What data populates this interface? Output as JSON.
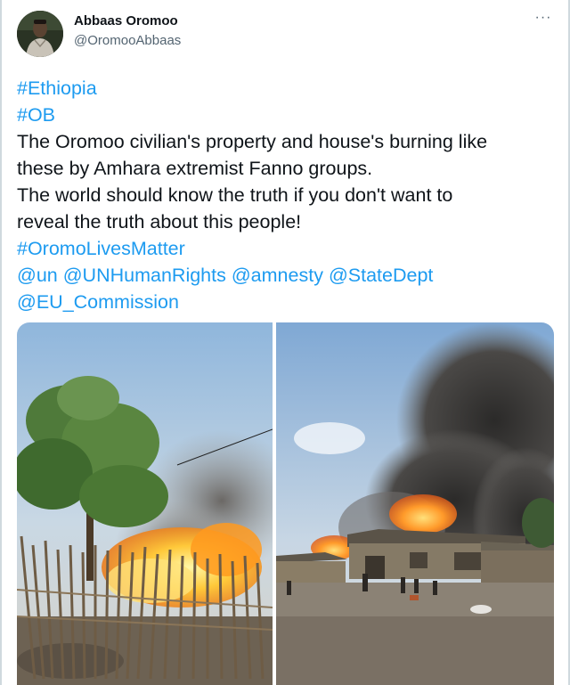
{
  "author": {
    "name": "Abbaas Oromoo",
    "handle": "@OromooAbbaas",
    "avatar_icon": "profile-photo"
  },
  "more_icon": "more-horizontal-icon",
  "more_label": "···",
  "tweet": {
    "lines": [
      {
        "parts": [
          {
            "text": "#Ethiopia",
            "link": true
          }
        ]
      },
      {
        "parts": [
          {
            "text": "#OB",
            "link": true
          }
        ]
      },
      {
        "parts": [
          {
            "text": "The Oromoo civilian's property and house's burning like",
            "link": false
          }
        ]
      },
      {
        "parts": [
          {
            "text": "these by Amhara extremist Fanno groups.",
            "link": false
          }
        ]
      },
      {
        "parts": [
          {
            "text": "The world should know the truth if you don't want to",
            "link": false
          }
        ]
      },
      {
        "parts": [
          {
            "text": "reveal the truth about this people!",
            "link": false
          }
        ]
      },
      {
        "parts": [
          {
            "text": "#OromoLivesMatter",
            "link": true
          }
        ]
      },
      {
        "parts": [
          {
            "text": "@un",
            "link": true
          },
          {
            "text": " ",
            "link": false
          },
          {
            "text": "@UNHumanRights",
            "link": true
          },
          {
            "text": " ",
            "link": false
          },
          {
            "text": "@amnesty",
            "link": true
          },
          {
            "text": " ",
            "link": false
          },
          {
            "text": "@StateDept",
            "link": true
          }
        ]
      },
      {
        "parts": [
          {
            "text": "@EU_Commission",
            "link": true
          }
        ]
      }
    ]
  },
  "media": {
    "photos": [
      {
        "icon": "photo-burning-fence-and-tree"
      },
      {
        "icon": "photo-burning-houses-smoke"
      }
    ]
  },
  "colors": {
    "link": "#1d9bf0",
    "text": "#0f1419",
    "secondary": "#536471"
  }
}
